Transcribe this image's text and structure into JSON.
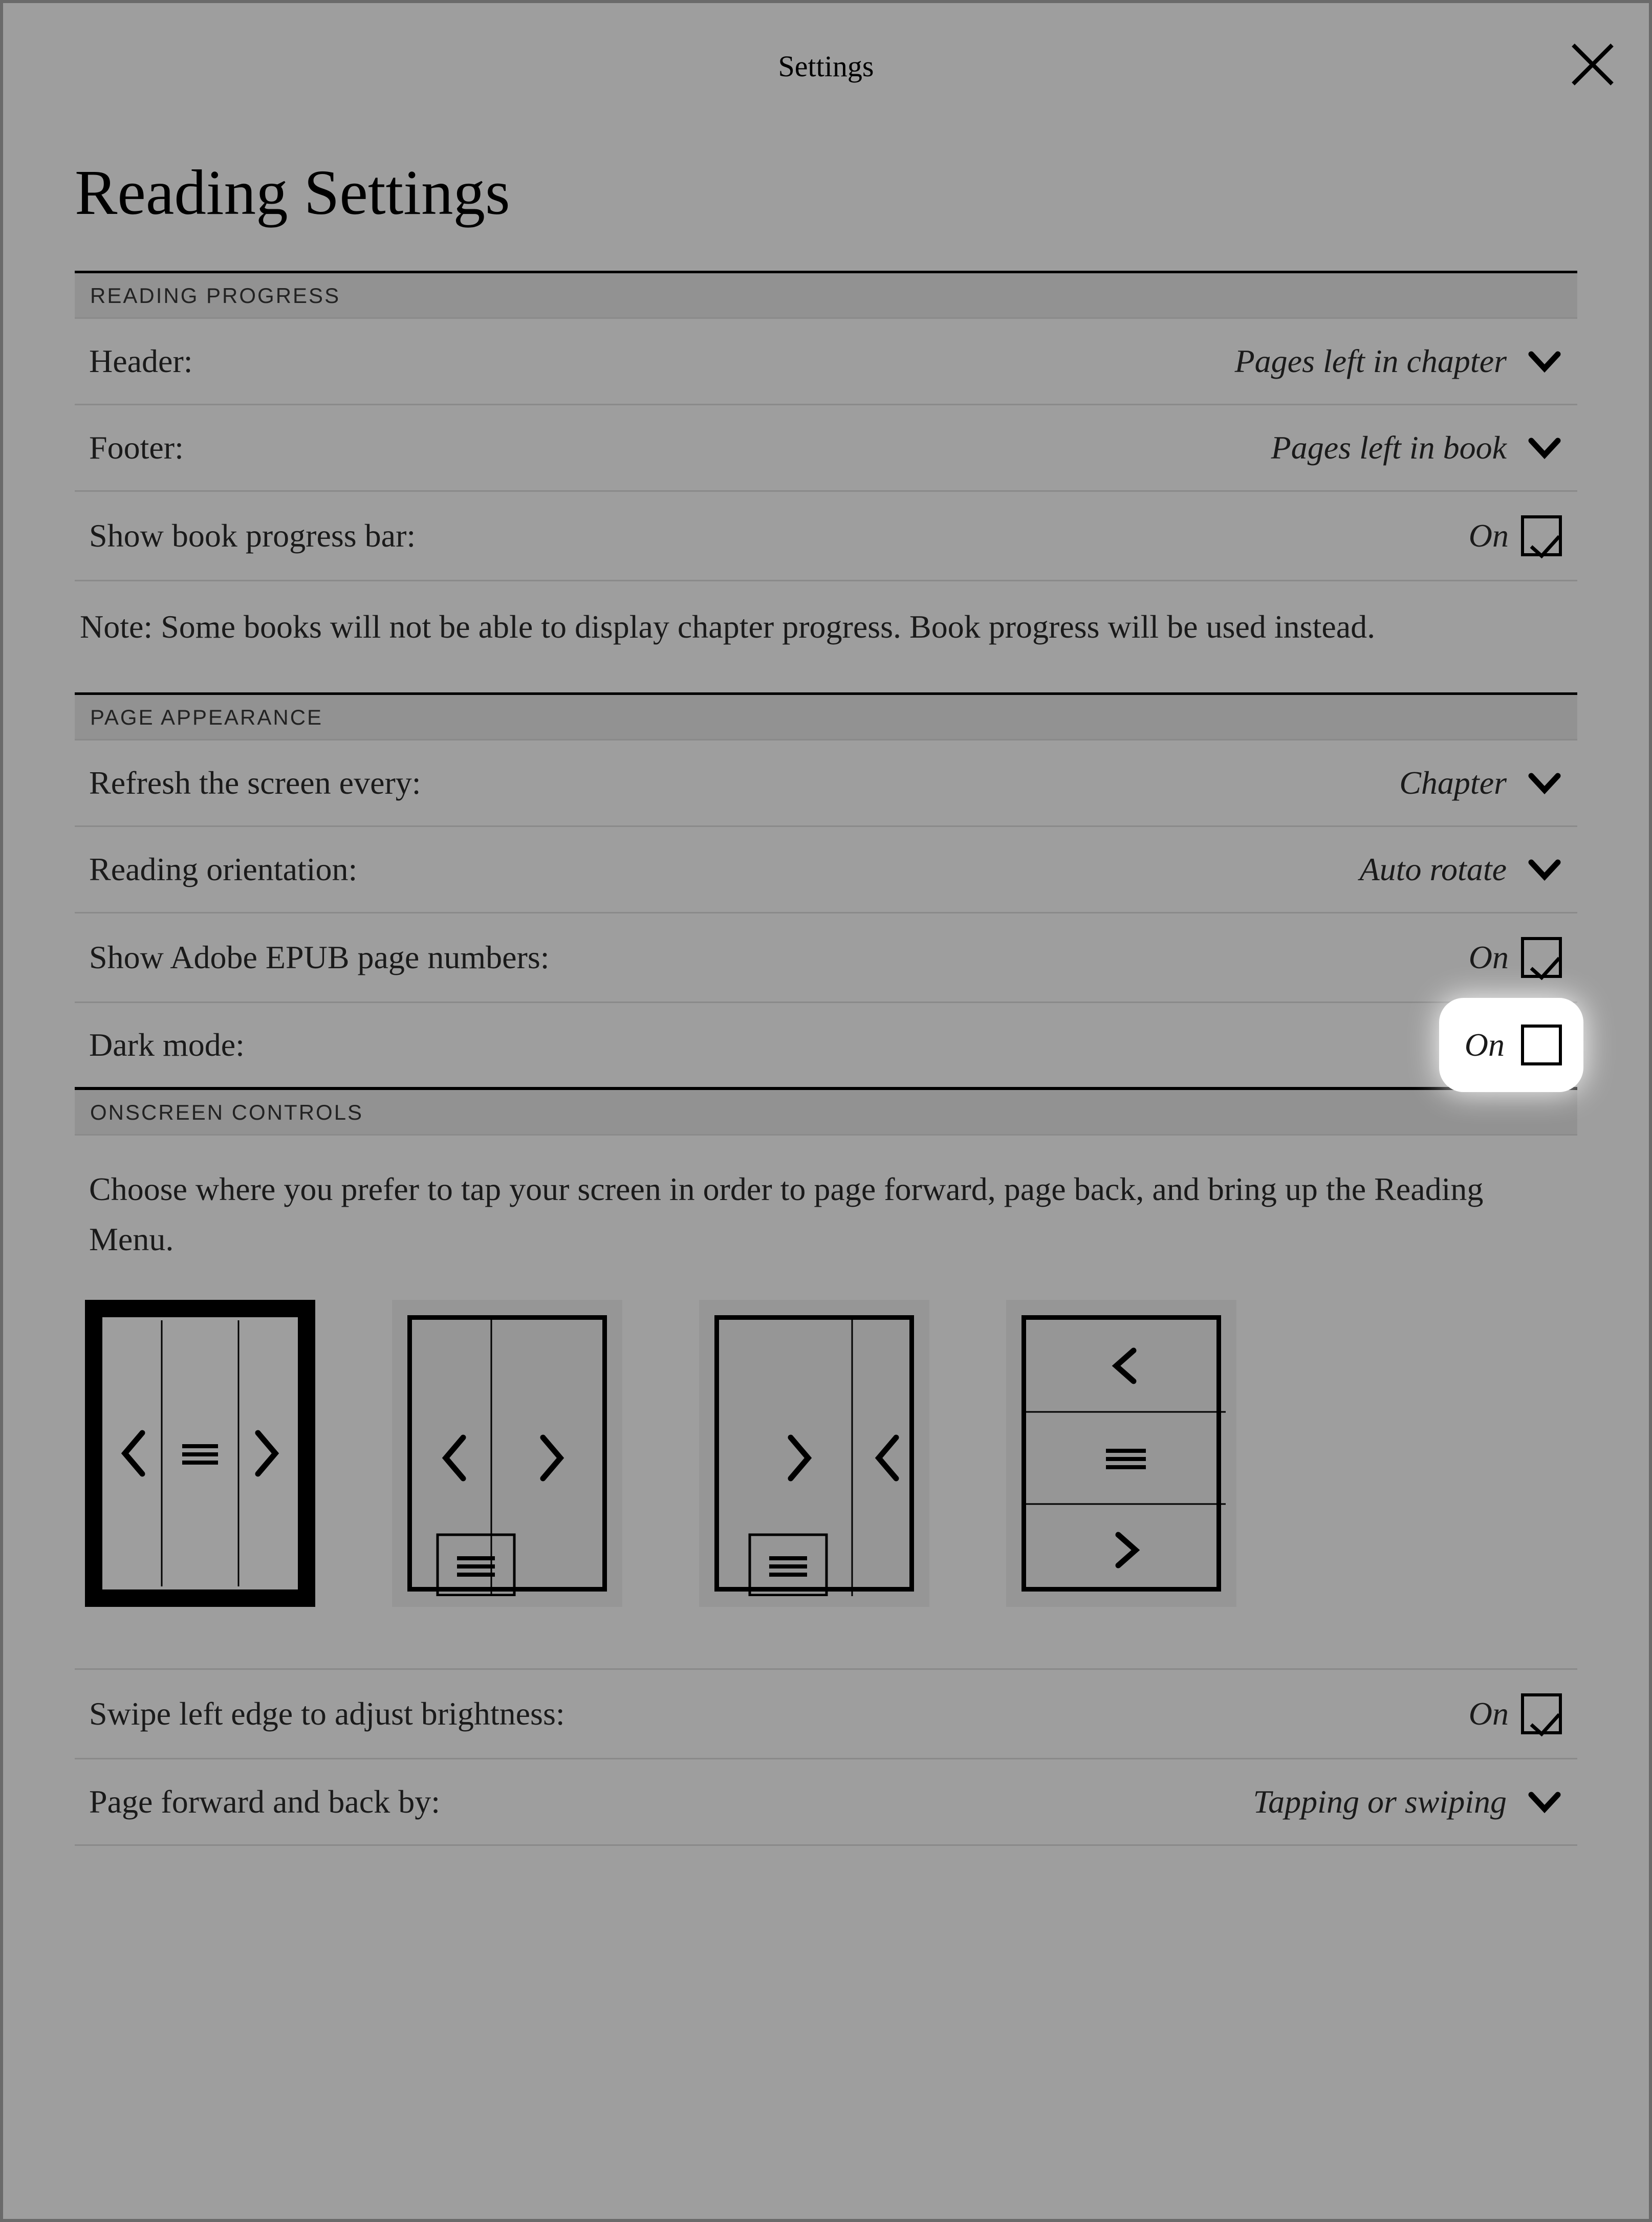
{
  "titlebar": {
    "title": "Settings"
  },
  "page": {
    "heading": "Reading Settings"
  },
  "sections": {
    "reading_progress": {
      "title": "READING PROGRESS",
      "header": {
        "label": "Header:",
        "value": "Pages left in chapter"
      },
      "footer": {
        "label": "Footer:",
        "value": "Pages left in book"
      },
      "progress_bar": {
        "label": "Show book progress bar:",
        "value": "On",
        "checked": true
      },
      "note": "Note: Some books will not be able to display chapter progress. Book progress will be used instead."
    },
    "page_appearance": {
      "title": "PAGE APPEARANCE",
      "refresh": {
        "label": "Refresh the screen every:",
        "value": "Chapter"
      },
      "orientation": {
        "label": "Reading orientation:",
        "value": "Auto rotate"
      },
      "adobe_epub": {
        "label": "Show Adobe EPUB page numbers:",
        "value": "On",
        "checked": true
      },
      "dark_mode": {
        "label": "Dark mode:",
        "value": "On",
        "checked": false
      }
    },
    "onscreen_controls": {
      "title": "ONSCREEN CONTROLS",
      "instruction": "Choose where you prefer to tap your screen in order to page forward, page back, and bring up the Reading Menu.",
      "selected_layout_index": 0,
      "swipe_brightness": {
        "label": "Swipe left edge to adjust brightness:",
        "value": "On",
        "checked": true
      },
      "page_forward_back": {
        "label": "Page forward and back by:",
        "value": "Tapping or swiping"
      }
    }
  }
}
